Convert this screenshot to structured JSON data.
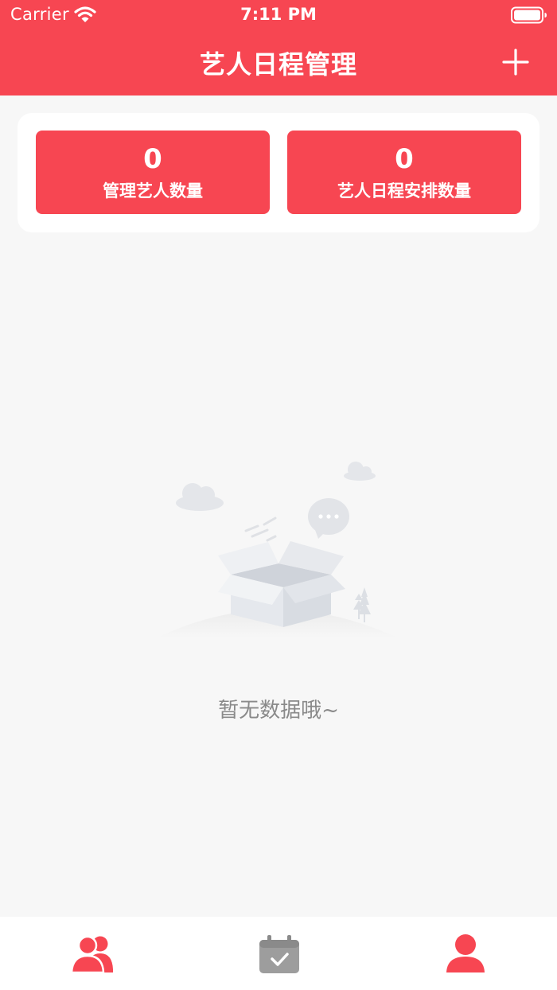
{
  "status_bar": {
    "carrier": "Carrier",
    "time": "7:11 PM",
    "wifi_icon": "wifi-icon",
    "battery_icon": "battery-icon"
  },
  "nav": {
    "title": "艺人日程管理",
    "add_icon": "plus-icon"
  },
  "summary": {
    "artists": {
      "value": "0",
      "label": "管理艺人数量"
    },
    "schedules": {
      "value": "0",
      "label": "艺人日程安排数量"
    }
  },
  "empty_state": {
    "icon": "empty-box-illustration",
    "text": "暂无数据哦~"
  },
  "tab_bar": {
    "items": [
      {
        "icon": "artists-icon",
        "active": true
      },
      {
        "icon": "calendar-check-icon",
        "active": false
      },
      {
        "icon": "profile-icon",
        "active": false
      }
    ]
  },
  "colors": {
    "brand": "#f74652",
    "background": "#f7f7f7",
    "inactive_icon": "#9d9d9d",
    "empty_text": "#8a8a8a"
  }
}
